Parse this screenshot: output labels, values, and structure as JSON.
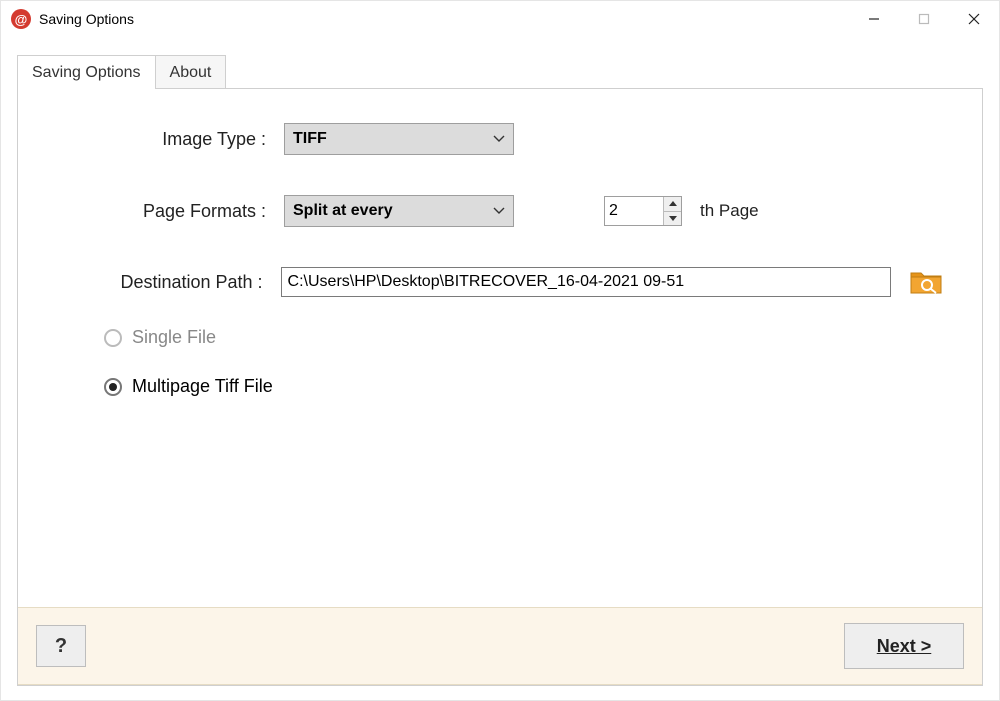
{
  "window": {
    "title": "Saving Options",
    "icon_glyph": "@"
  },
  "tabs": [
    {
      "label": "Saving Options",
      "active": true
    },
    {
      "label": "About",
      "active": false
    }
  ],
  "form": {
    "image_type_label": "Image Type  :",
    "image_type_value": "TIFF",
    "page_formats_label": "Page Formats  :",
    "page_formats_value": "Split at every",
    "page_number_value": "2",
    "page_suffix": "th Page",
    "destination_label": "Destination Path  :",
    "destination_value": "C:\\Users\\HP\\Desktop\\BITRECOVER_16-04-2021 09-51"
  },
  "radios": {
    "single_label": "Single File",
    "multi_label": "Multipage Tiff File",
    "selected": "multi"
  },
  "footer": {
    "help_label": "?",
    "next_label": "Next >"
  }
}
